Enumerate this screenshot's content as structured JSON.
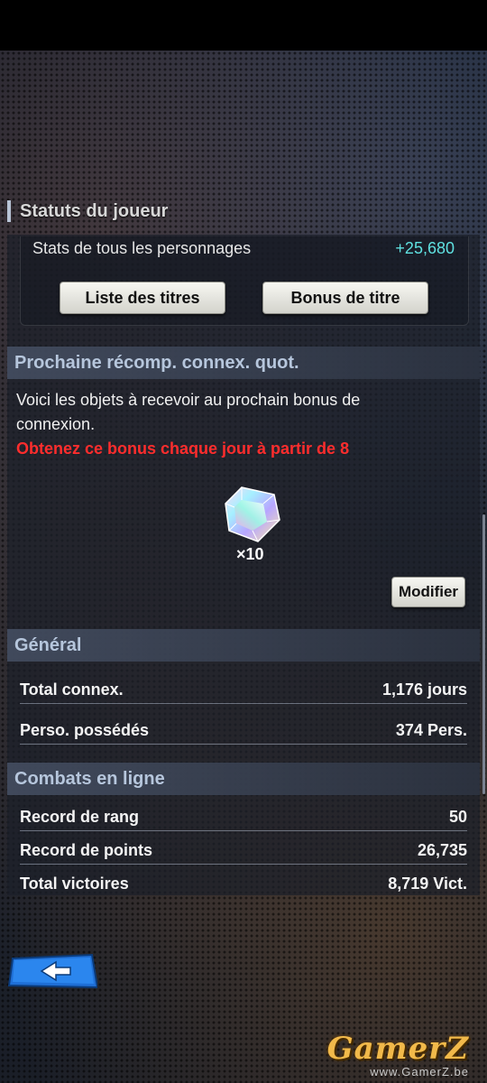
{
  "player_status": {
    "section_title": "Statuts du joueur",
    "all_chars_label": "Stats de tous les personnages",
    "all_chars_value": "+25,680",
    "titles_list_button": "Liste des titres",
    "title_bonus_button": "Bonus de titre"
  },
  "daily_login": {
    "header": "Prochaine récomp. connex. quot.",
    "line1": "Voici les objets à recevoir au prochain bonus de",
    "line2": "connexion.",
    "notice": "Obtenez ce bonus chaque jour à partir de 8",
    "item_icon": "rainbow-crystal-icon",
    "item_qty": "×10",
    "modify_button": "Modifier"
  },
  "general": {
    "header": "Général",
    "rows": [
      {
        "label": "Total connex.",
        "value": "1,176 jours"
      },
      {
        "label": "Perso. possédés",
        "value": "374 Pers."
      }
    ]
  },
  "online_battles": {
    "header": "Combats en ligne",
    "rows": [
      {
        "label": "Record de rang",
        "value": "50"
      },
      {
        "label": "Record de points",
        "value": "26,735"
      },
      {
        "label": "Total victoires",
        "value": "8,719 Vict."
      }
    ]
  },
  "nav": {
    "back_icon": "back-arrow-icon"
  },
  "watermark": {
    "name": "GamerZ",
    "url": "www.GamerZ.be"
  },
  "colors": {
    "accent_cyan": "#5fe0e0",
    "notice_red": "#ff2d2d",
    "header_text": "#b6c6dc"
  }
}
